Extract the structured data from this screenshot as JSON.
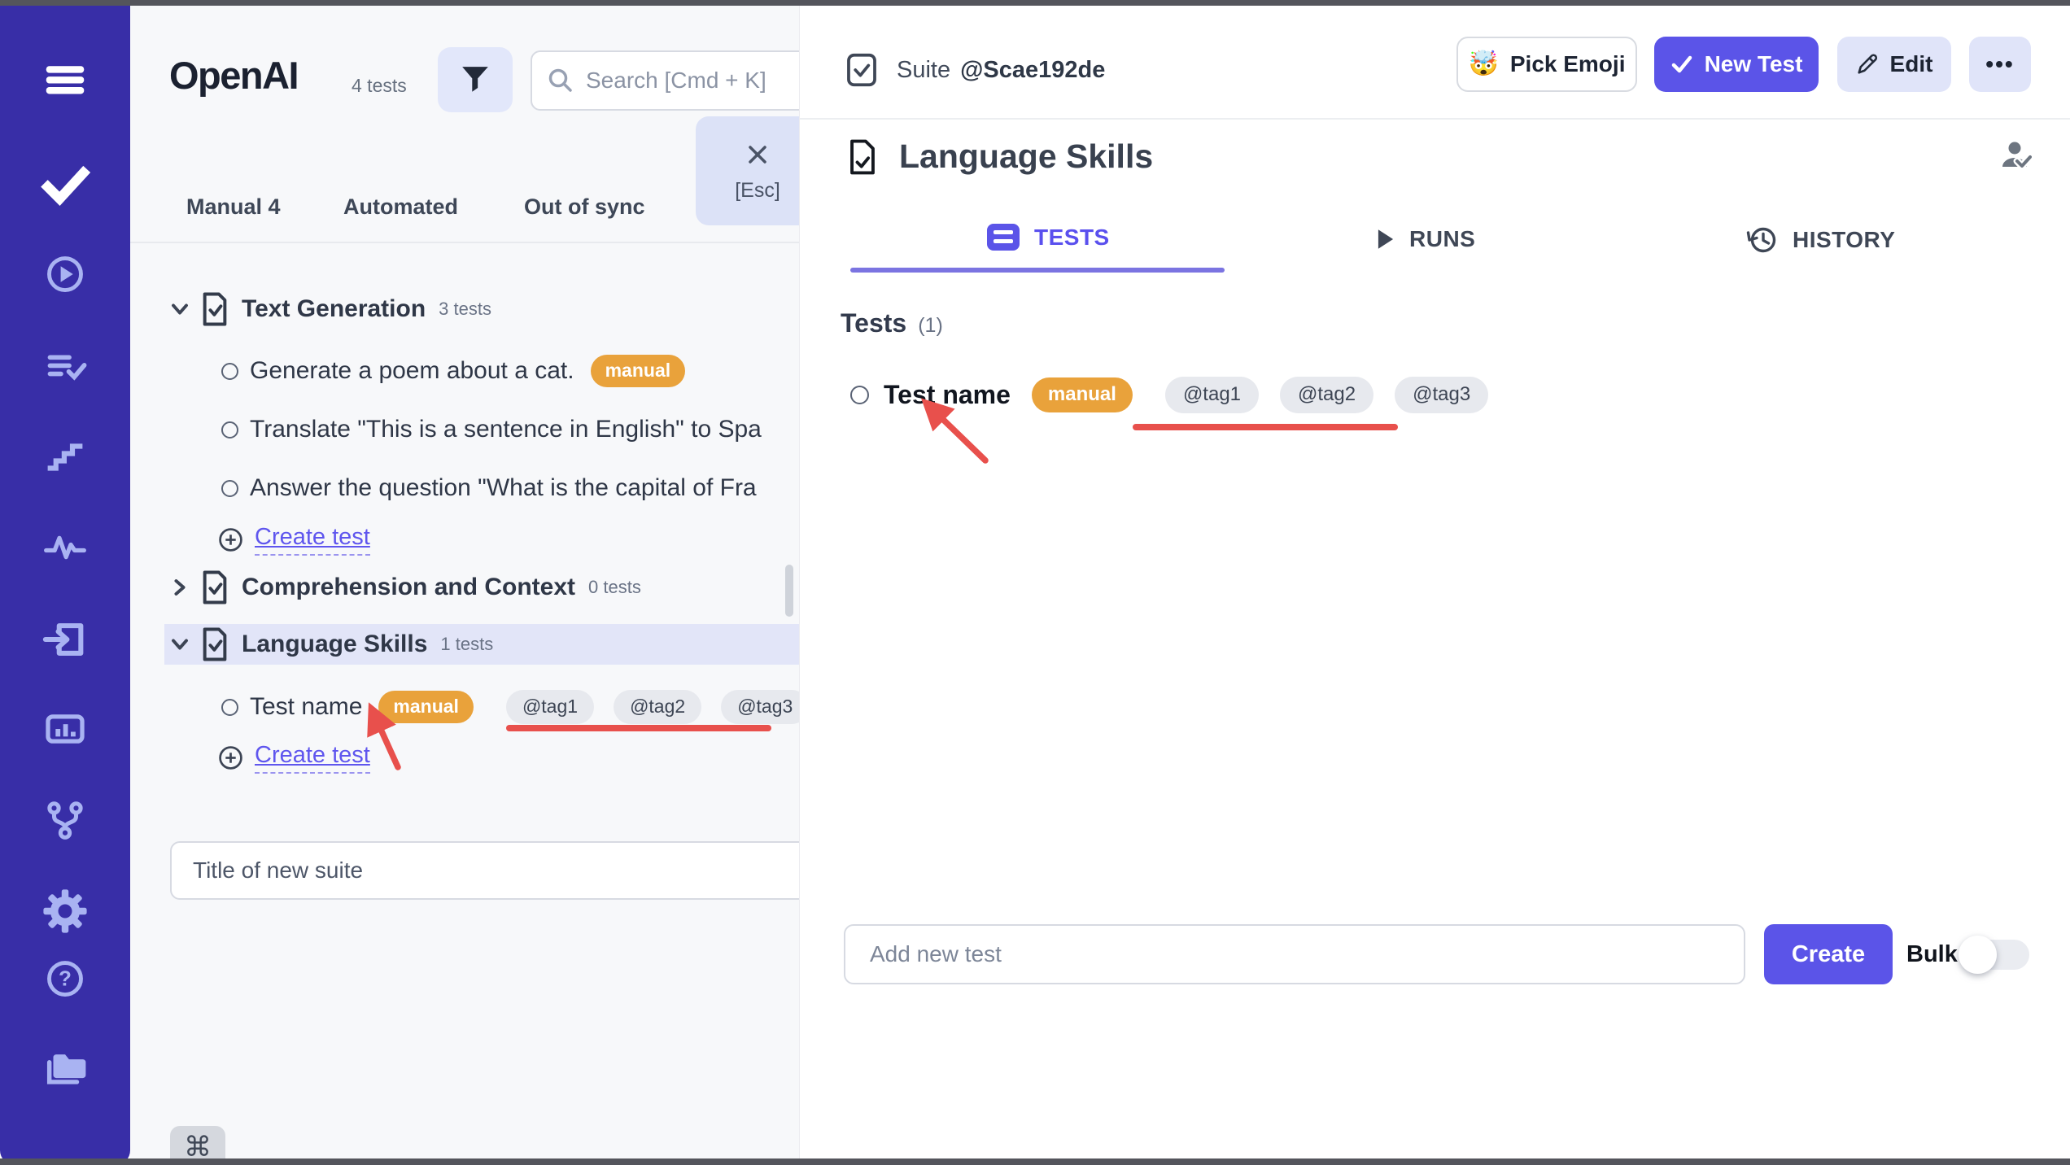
{
  "colors": {
    "sidebar_purple": "#382ea7",
    "accent_purple": "#5b54e8",
    "light_purple_button": "#e0e4f9",
    "active_tab_purple": "#5a50ee",
    "badge_orange": "#e9a23b",
    "tag_gray_bg": "#e7e9ee",
    "annotation_red": "#e8504c",
    "left_panel_bg": "#f7f8fa",
    "selected_row_bg": "#e2e5f8"
  },
  "sidebar": {
    "icons": [
      "menu",
      "check",
      "play-circle",
      "list-check",
      "steps",
      "activity",
      "sign-in",
      "bar-chart",
      "git-branch",
      "settings-gear",
      "help-circle",
      "folder",
      "user-avatar"
    ]
  },
  "left_panel": {
    "logo": "OpenAI",
    "tests_count": "4 tests",
    "search_placeholder": "Search [Cmd + K]",
    "esc_tooltip": {
      "label": "[Esc]"
    },
    "tabs": [
      {
        "label": "Manual 4"
      },
      {
        "label": "Automated"
      },
      {
        "label": "Out of sync"
      }
    ],
    "tree": {
      "suite1": {
        "label": "Text Generation",
        "count": "3 tests"
      },
      "suite1_tests": [
        {
          "label": "Generate a poem about a cat.",
          "badge": "manual"
        },
        {
          "label": "Translate \"This is a sentence in English\" to Spa"
        },
        {
          "label": "Answer the question \"What is the capital of Fra"
        }
      ],
      "create_test_label": "Create test",
      "suite2": {
        "label": "Comprehension and Context",
        "count": "0 tests"
      },
      "suite3": {
        "label": "Language Skills",
        "count": "1 tests"
      },
      "suite3_tests": [
        {
          "label": "Test name",
          "badge": "manual",
          "tags": [
            "@tag1",
            "@tag2",
            "@tag3"
          ]
        }
      ]
    },
    "new_suite_placeholder": "Title of new suite",
    "cmd_symbol": "⌘"
  },
  "right_panel": {
    "suite_label": "Suite",
    "suite_id": "@Scae192de",
    "header_buttons": {
      "pick_emoji_emoji": "🤯",
      "pick_emoji": "Pick Emoji",
      "new_test_check": "✓",
      "new_test": "New Test",
      "edit": "Edit",
      "more": "•••"
    },
    "title": "Language Skills",
    "tabs": [
      {
        "label": "TESTS",
        "active": true
      },
      {
        "label": "RUNS",
        "active": false
      },
      {
        "label": "HISTORY",
        "active": false
      }
    ],
    "tests_heading": "Tests",
    "tests_count": "(1)",
    "test": {
      "name": "Test name",
      "badge": "manual",
      "tags": [
        "@tag1",
        "@tag2",
        "@tag3"
      ]
    },
    "add_test_placeholder": "Add new test",
    "create_button": "Create",
    "bulk_label": "Bulk"
  }
}
